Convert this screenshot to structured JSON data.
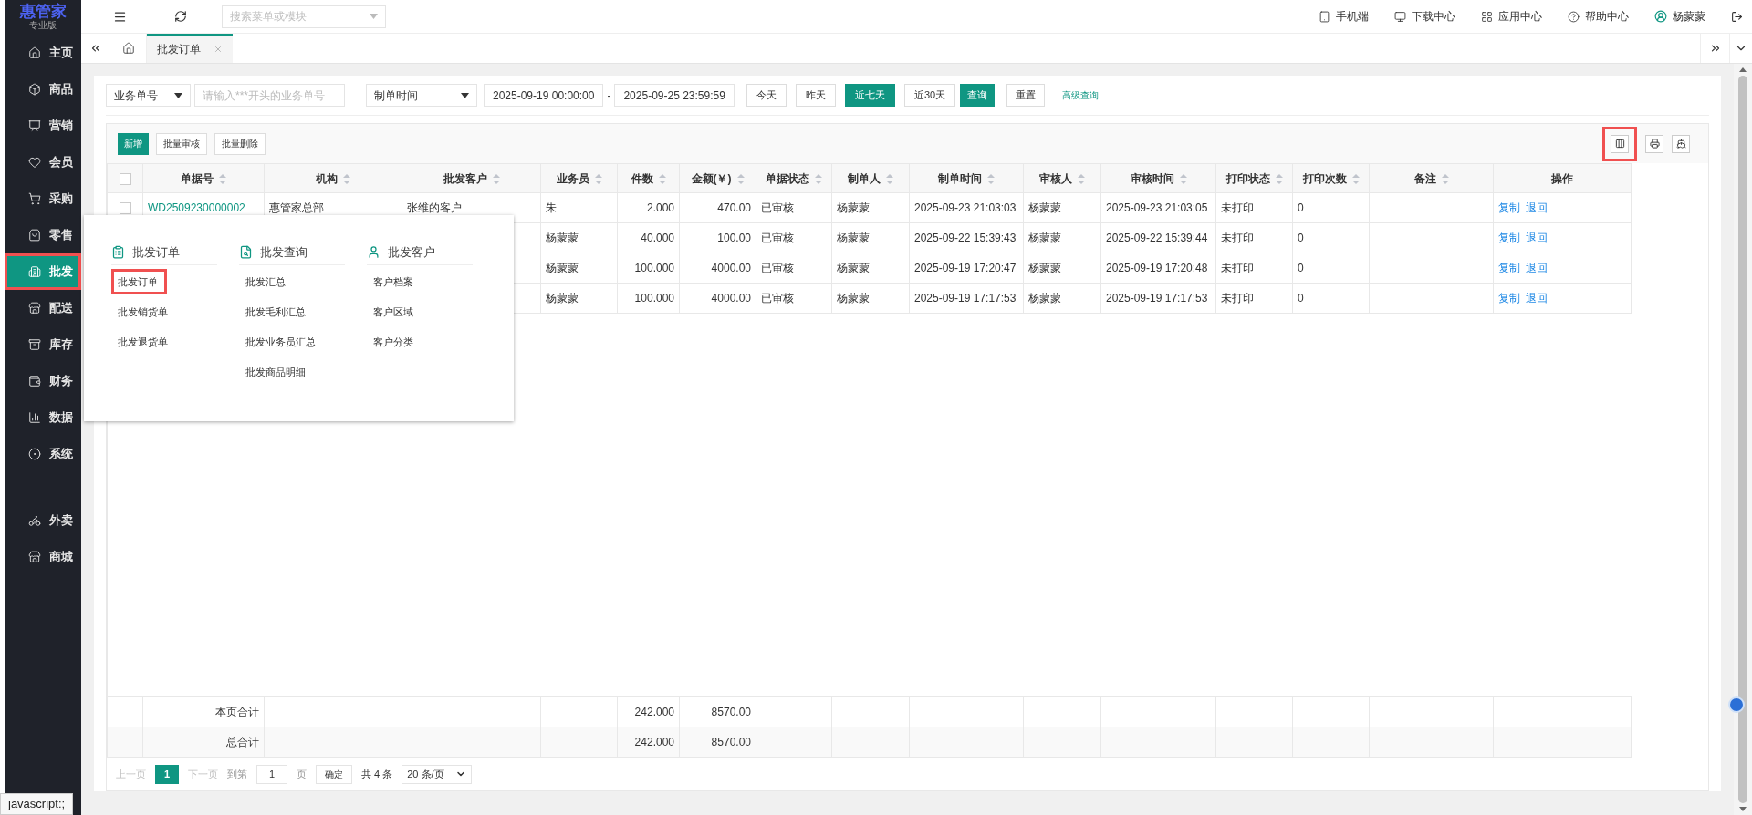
{
  "logo": {
    "name": "惠管家",
    "edition": "— 专业版 —"
  },
  "sidebar": {
    "items": [
      {
        "label": "主页",
        "selected": false,
        "annotated": false
      },
      {
        "label": "商品",
        "selected": false,
        "annotated": false
      },
      {
        "label": "营销",
        "selected": false,
        "annotated": false
      },
      {
        "label": "会员",
        "selected": false,
        "annotated": false
      },
      {
        "label": "采购",
        "selected": false,
        "annotated": false
      },
      {
        "label": "零售",
        "selected": false,
        "annotated": false
      },
      {
        "label": "批发",
        "selected": true,
        "annotated": true
      },
      {
        "label": "配送",
        "selected": false,
        "annotated": false
      },
      {
        "label": "库存",
        "selected": false,
        "annotated": false
      },
      {
        "label": "财务",
        "selected": false,
        "annotated": false
      },
      {
        "label": "数据",
        "selected": false,
        "annotated": false
      },
      {
        "label": "系统",
        "selected": false,
        "annotated": false
      }
    ],
    "extra_items": [
      {
        "label": "外卖",
        "selected": false
      },
      {
        "label": "商城",
        "selected": false
      }
    ]
  },
  "header": {
    "search": {
      "placeholder": "搜索菜单或模块"
    },
    "links": [
      "手机端",
      "下载中心",
      "应用中心",
      "帮助中心"
    ],
    "user": "杨蒙蒙"
  },
  "tabs": [
    {
      "label": "批发订单",
      "selected": true
    }
  ],
  "filters": {
    "field_select": "业务单号",
    "keyword": {
      "placeholder": "请输入***开头的业务单号"
    },
    "time_select": "制单时间",
    "date_start": "2025-09-19 00:00:00",
    "separator": "-",
    "date_end": "2025-09-25 23:59:59",
    "ranges": [
      {
        "label": "今天",
        "selected": false
      },
      {
        "label": "昨天",
        "selected": false
      },
      {
        "label": "近七天",
        "selected": true
      },
      {
        "label": "近30天",
        "selected": false
      }
    ],
    "query": "查询",
    "reset": "重置",
    "advanced": "高级查询"
  },
  "toolbar": {
    "buttons": [
      {
        "label": "新增",
        "primary": true
      },
      {
        "label": "批量审核",
        "primary": false
      },
      {
        "label": "批量删除",
        "primary": false
      }
    ],
    "tools": [
      {
        "kind": "columns",
        "annotated": true
      },
      {
        "kind": "print",
        "annotated": false
      },
      {
        "kind": "export",
        "annotated": false
      }
    ]
  },
  "header_checked": false,
  "table": {
    "columns": [
      {
        "label": "单据号",
        "sortable": true
      },
      {
        "label": "机构",
        "sortable": true
      },
      {
        "label": "批发客户",
        "sortable": true
      },
      {
        "label": "业务员",
        "sortable": true
      },
      {
        "label": "件数",
        "sortable": true
      },
      {
        "label": "金额(￥)",
        "sortable": true
      },
      {
        "label": "单据状态",
        "sortable": true
      },
      {
        "label": "制单人",
        "sortable": true
      },
      {
        "label": "制单时间",
        "sortable": true
      },
      {
        "label": "审核人",
        "sortable": true
      },
      {
        "label": "审核时间",
        "sortable": true
      },
      {
        "label": "打印状态",
        "sortable": true
      },
      {
        "label": "打印次数",
        "sortable": true
      },
      {
        "label": "备注",
        "sortable": true
      },
      {
        "label": "操作",
        "sortable": false
      }
    ],
    "rows": [
      {
        "checked": false,
        "cells": [
          "WD2509230000002",
          "惠管家总部",
          "张维的客户",
          "朱",
          "2.000",
          "470.00",
          "已审核",
          "杨蒙蒙",
          "2025-09-23 21:03:03",
          "杨蒙蒙",
          "2025-09-23 21:03:05",
          "未打印",
          "0",
          null
        ],
        "actions": [
          "复制",
          "退回"
        ]
      },
      {
        "cells": [
          null,
          null,
          null,
          "杨蒙蒙",
          "40.000",
          "100.00",
          "已审核",
          "杨蒙蒙",
          "2025-09-22 15:39:43",
          "杨蒙蒙",
          "2025-09-22 15:39:44",
          "未打印",
          "0",
          null
        ],
        "actions": [
          "复制",
          "退回"
        ]
      },
      {
        "cells": [
          null,
          null,
          null,
          "杨蒙蒙",
          "100.000",
          "4000.00",
          "已审核",
          "杨蒙蒙",
          "2025-09-19 17:20:47",
          "杨蒙蒙",
          "2025-09-19 17:20:48",
          "未打印",
          "0",
          null
        ],
        "actions": [
          "复制",
          "退回"
        ]
      },
      {
        "cells": [
          null,
          null,
          null,
          "杨蒙蒙",
          "100.000",
          "4000.00",
          "已审核",
          "杨蒙蒙",
          "2025-09-19 17:17:53",
          "杨蒙蒙",
          "2025-09-19 17:17:53",
          "未打印",
          "0",
          null
        ],
        "actions": [
          "复制",
          "退回"
        ]
      }
    ],
    "totals": [
      {
        "label": "本页合计",
        "count": "242.000",
        "amount": "8570.00"
      },
      {
        "label": "总合计",
        "count": "242.000",
        "amount": "8570.00"
      }
    ]
  },
  "pagination": {
    "prev": "上一页",
    "pages": [
      {
        "label": "1",
        "selected": true
      }
    ],
    "next": "下一页",
    "goto": "到第",
    "page_input": "1",
    "page_unit": "页",
    "confirm": "确定",
    "total": "共 4 条",
    "page_size": "20 条/页"
  },
  "menu": {
    "groups": [
      {
        "title": "批发订单",
        "items": [
          {
            "label": "批发订单",
            "annotated": true
          },
          {
            "label": "批发销货单",
            "annotated": false
          },
          {
            "label": "批发退货单",
            "annotated": false
          }
        ]
      },
      {
        "title": "批发查询",
        "items": [
          {
            "label": "批发汇总",
            "annotated": false
          },
          {
            "label": "批发毛利汇总",
            "annotated": false
          },
          {
            "label": "批发业务员汇总",
            "annotated": false
          },
          {
            "label": "批发商品明细",
            "annotated": false
          }
        ]
      },
      {
        "title": "批发客户",
        "items": [
          {
            "label": "客户档案",
            "annotated": false
          },
          {
            "label": "客户区域",
            "annotated": false
          },
          {
            "label": "客户分类",
            "annotated": false
          }
        ]
      }
    ]
  },
  "status_bar": {
    "url": "javascript:;"
  }
}
